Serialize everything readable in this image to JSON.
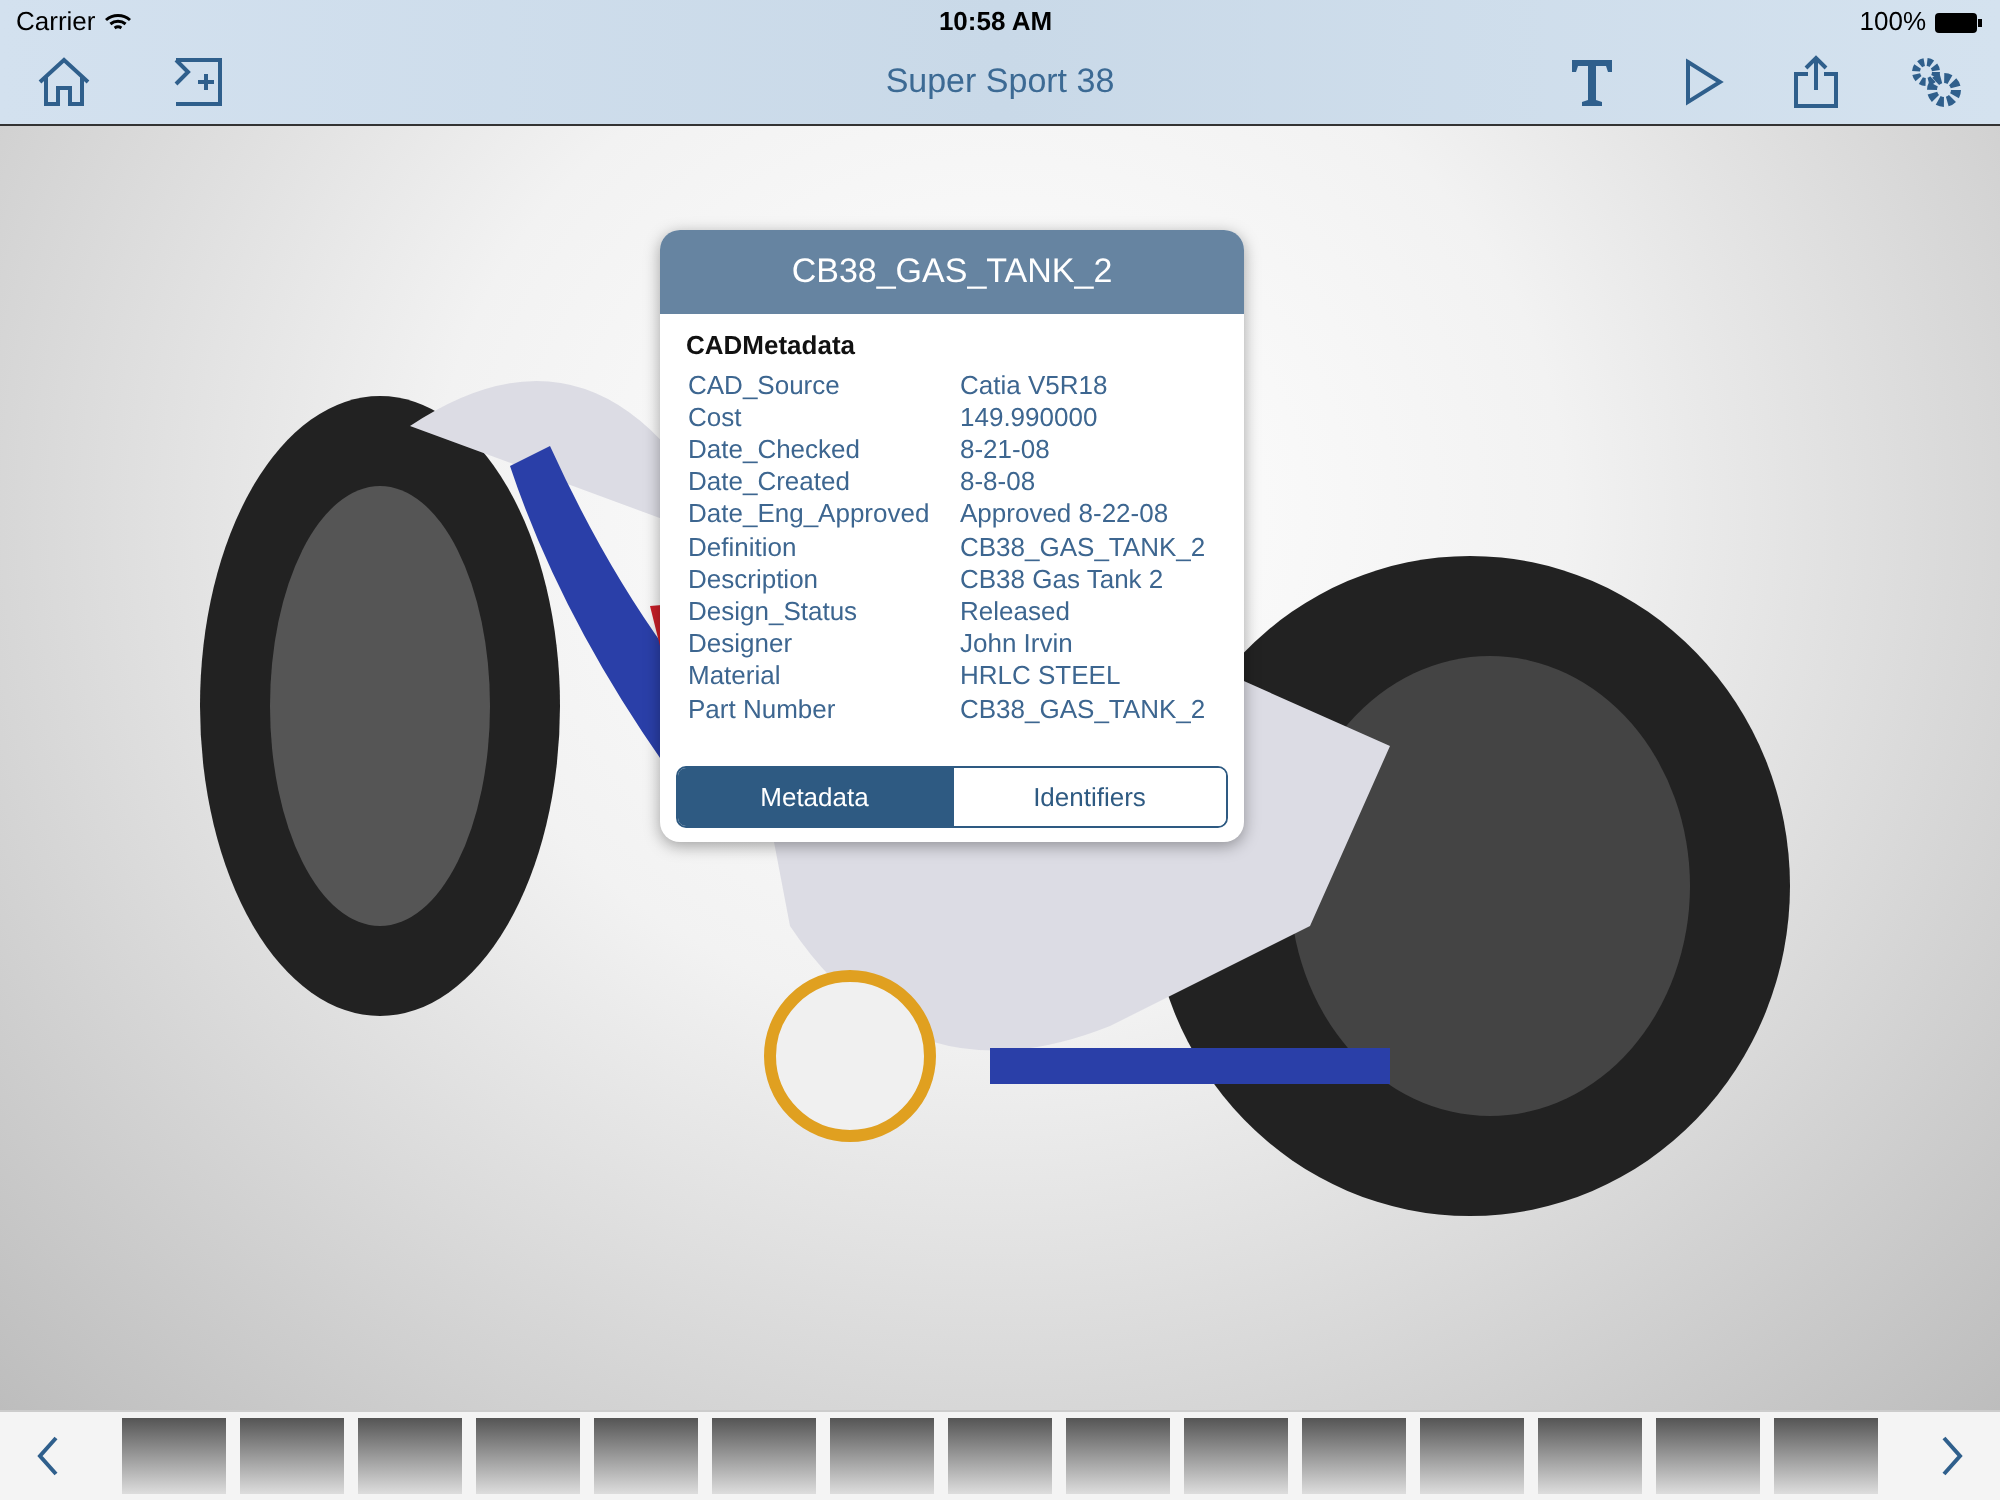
{
  "status_bar": {
    "carrier": "Carrier",
    "time": "10:58 AM",
    "battery": "100%"
  },
  "nav_bar": {
    "title": "Super Sport 38"
  },
  "popover": {
    "title": "CB38_GAS_TANK_2",
    "section": "CADMetadata",
    "rows": [
      {
        "key": "CAD_Source",
        "value": "Catia V5R18"
      },
      {
        "key": "Cost",
        "value": "149.990000"
      },
      {
        "key": "Date_Checked",
        "value": "8-21-08"
      },
      {
        "key": "Date_Created",
        "value": "8-8-08"
      },
      {
        "key": "Date_Eng_Approved",
        "value": "Approved 8-22-08"
      },
      {
        "key": "Definition",
        "value": "CB38_GAS_TANK_2"
      },
      {
        "key": "Description",
        "value": "CB38 Gas Tank 2"
      },
      {
        "key": "Design_Status",
        "value": "Released"
      },
      {
        "key": "Designer",
        "value": "John Irvin"
      },
      {
        "key": "Material",
        "value": "HRLC STEEL"
      },
      {
        "key": "Part Number",
        "value": "CB38_GAS_TANK_2"
      }
    ],
    "tabs": [
      {
        "label": "Metadata",
        "selected": true
      },
      {
        "label": "Identifiers",
        "selected": false
      }
    ]
  }
}
